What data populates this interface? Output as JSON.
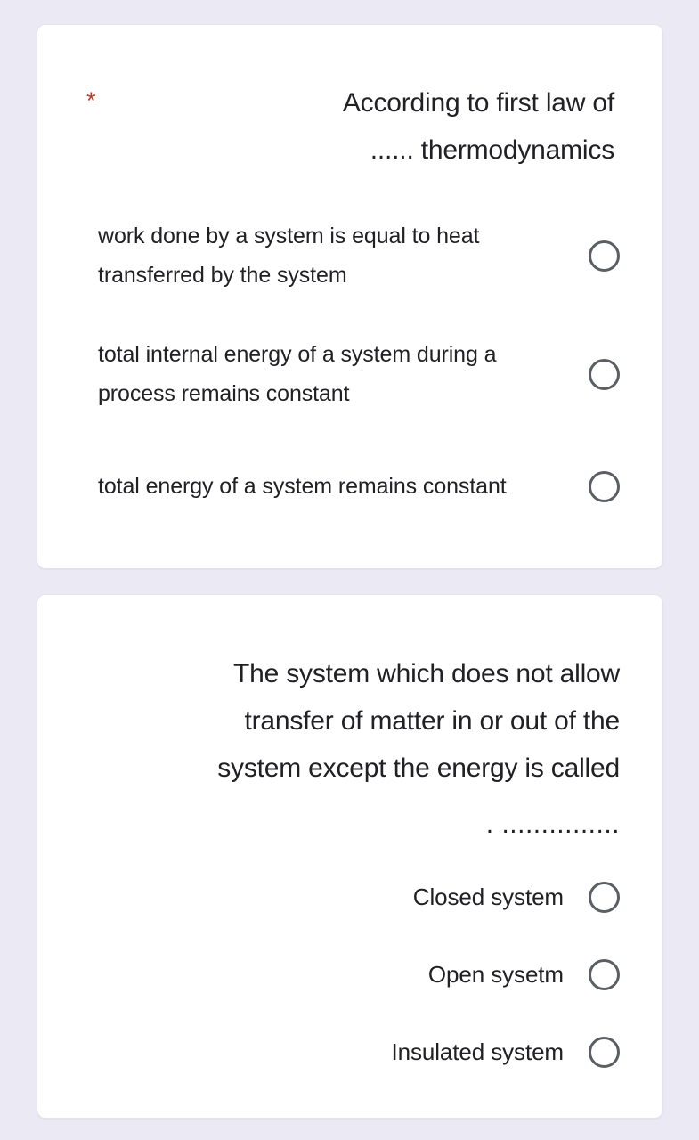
{
  "theme": {
    "page_background": "#ebe9f4",
    "card_background": "#ffffff",
    "text_color": "#212125",
    "required_marker_color": "#b93f2d",
    "radio_border_color": "#5b5f63"
  },
  "questions": [
    {
      "required_marker": "*",
      "title_line_1": "According to first law of",
      "title_line_2": "...... thermodynamics",
      "options": [
        {
          "label": "work done by a system is equal to heat transferred by the system",
          "selected": false
        },
        {
          "label": "total internal energy of a system during a process remains constant",
          "selected": false
        },
        {
          "label": "total energy of a system remains constant",
          "selected": false
        }
      ]
    },
    {
      "title_line_1": "The system which does not allow",
      "title_line_2": "transfer of matter in or out of the",
      "title_line_3": "system except the energy is called",
      "blank_dots": ". ...............",
      "options": [
        {
          "label": "Closed system",
          "selected": false
        },
        {
          "label": "Open sysetm",
          "selected": false
        },
        {
          "label": "Insulated system",
          "selected": false
        }
      ]
    }
  ]
}
